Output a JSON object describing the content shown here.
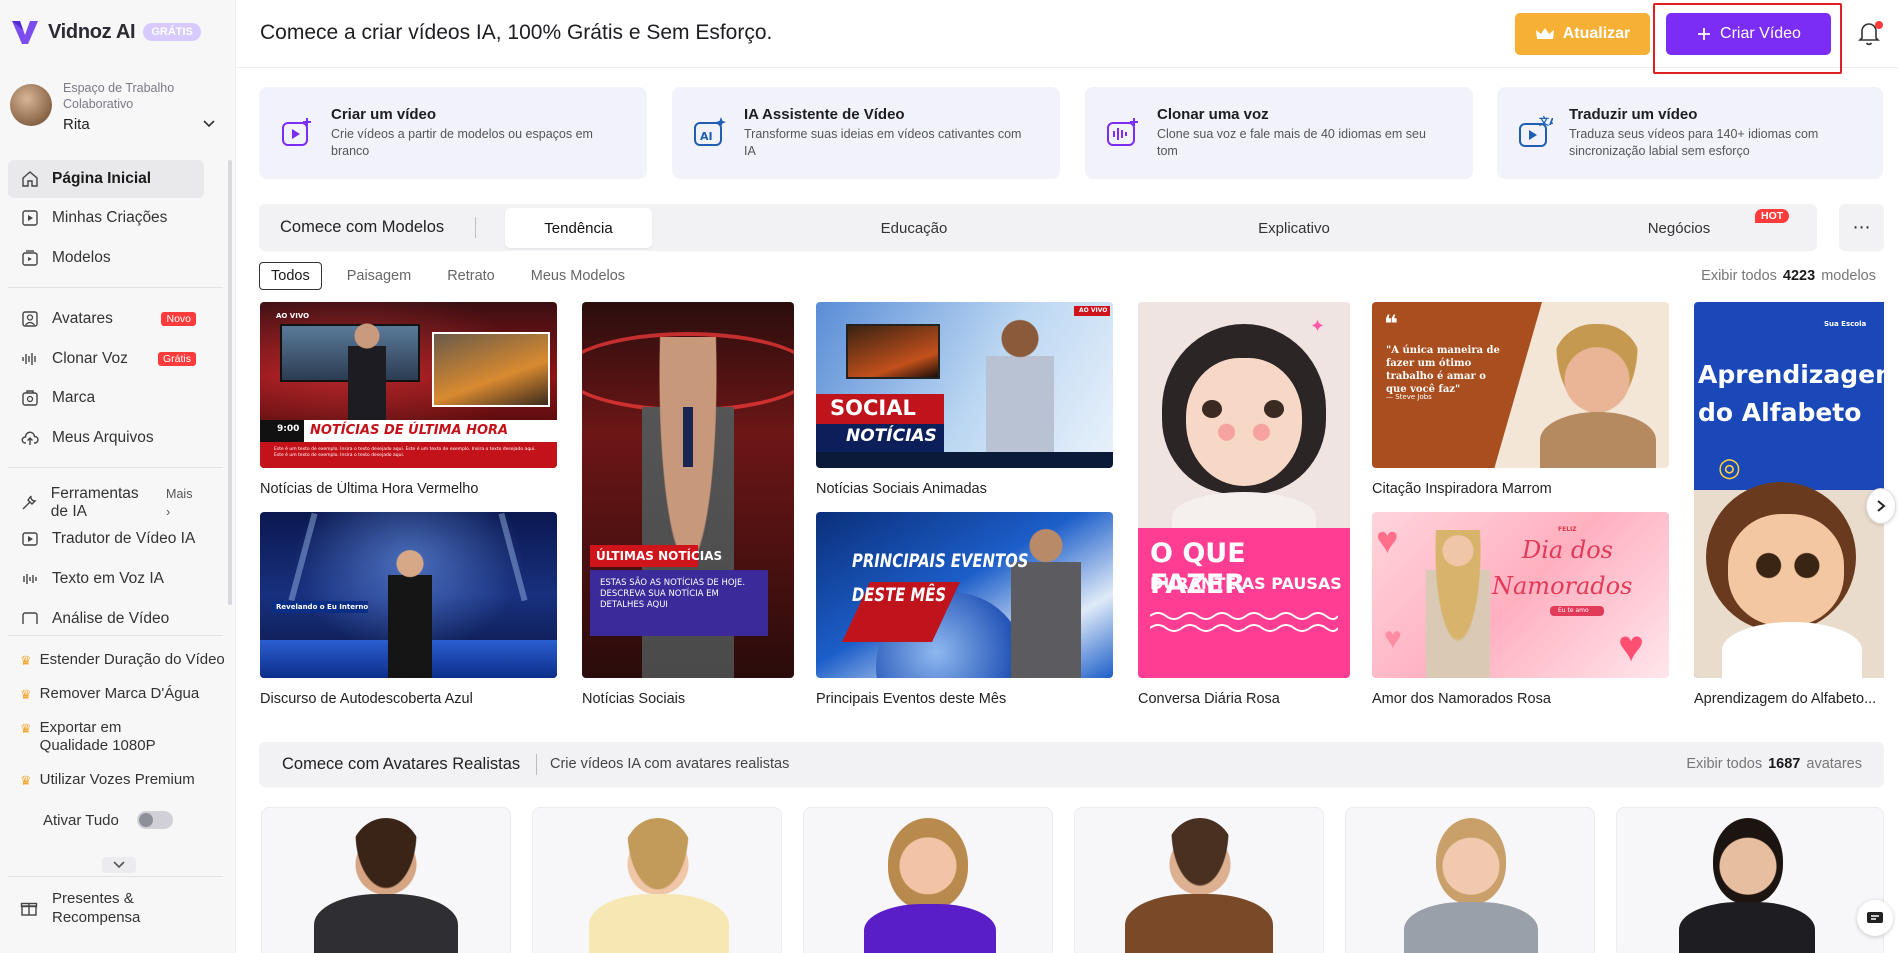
{
  "app": {
    "name": "Vidnoz AI",
    "plan_badge": "GRÁTIS",
    "workspace_label": "Espaço de Trabalho Colaborativo",
    "workspace_user": "Rita"
  },
  "sidebar": {
    "main_items": [
      {
        "label": "Página Inicial",
        "icon": "home-icon"
      },
      {
        "label": "Minhas Criações",
        "icon": "play-square-icon"
      },
      {
        "label": "Modelos",
        "icon": "template-icon"
      }
    ],
    "tool_items": [
      {
        "label": "Avatares",
        "icon": "avatar-icon",
        "badge": "Novo"
      },
      {
        "label": "Clonar Voz",
        "icon": "waveform-icon",
        "badge": "Grátis"
      },
      {
        "label": "Marca",
        "icon": "brand-icon"
      },
      {
        "label": "Meus Arquivos",
        "icon": "cloud-upload-icon"
      }
    ],
    "ai_tools": {
      "label": "Ferramentas de IA",
      "more": "Mais"
    },
    "ai_items": [
      {
        "label": "Tradutor de Vídeo IA",
        "icon": "translate-video-icon"
      },
      {
        "label": "Texto em Voz IA",
        "icon": "tts-icon"
      },
      {
        "label": "Análise de Vídeo",
        "icon": "analysis-icon"
      }
    ],
    "premium_items": [
      "Estender Duração do Vídeo",
      "Remover Marca D'Água",
      "Exportar em Qualidade 1080P",
      "Utilizar Vozes Premium"
    ],
    "activate_all": "Ativar Tudo",
    "gifts": "Presentes & Recompensa"
  },
  "header": {
    "title": "Comece a criar vídeos IA, 100% Grátis e Sem Esforço.",
    "upgrade_label": "Atualizar",
    "create_label": "Criar Vídeo"
  },
  "features": [
    {
      "title": "Criar um vídeo",
      "desc": "Crie vídeos a partir de modelos ou espaços em branco"
    },
    {
      "title": "IA Assistente de Vídeo",
      "desc": "Transforme suas ideias em vídeos cativantes com IA"
    },
    {
      "title": "Clonar uma voz",
      "desc": "Clone sua voz e fale mais de 40 idiomas em seu tom"
    },
    {
      "title": "Traduzir um vídeo",
      "desc": "Traduza seus vídeos para 140+ idiomas com sincronização labial sem esforço"
    }
  ],
  "templates": {
    "section_label": "Comece com Modelos",
    "tabs": [
      "Tendência",
      "Educação",
      "Explicativo",
      "Negócios"
    ],
    "hot_badge": "HOT",
    "filters": [
      "Todos",
      "Paisagem",
      "Retrato",
      "Meus Modelos"
    ],
    "count_prefix": "Exibir todos",
    "count": "4223",
    "count_suffix": "modelos",
    "items": [
      "Notícias de Última Hora Vermelho",
      "Discurso de Autodescoberta Azul",
      "Notícias Sociais",
      "Notícias Sociais Animadas",
      "Principais Eventos deste Mês",
      "Conversa Diária Rosa",
      "Citação Inspiradora Marrom",
      "Amor dos Namorados Rosa",
      "Aprendizagem do Alfabeto..."
    ],
    "overlays": {
      "t1_live": "AO VIVO",
      "t1_time": "9:00",
      "t1_headline": "NOTÍCIAS DE ÚLTIMA HORA",
      "t1_ticker": "Este é um texto de exemplo. Insira o texto desejado aqui. Este é um texto de exemplo. Insira o texto desejado aqui. Este é um texto de exemplo. Insira o texto desejado aqui.",
      "t2_tag": "Revelando o Eu Interno",
      "t3_headline": "ÚLTIMAS NOTÍCIAS",
      "t3_body": "ESTAS SÃO AS NOTÍCIAS DE HOJE. DESCREVA SUA NOTÍCIA EM DETALHES AQUI",
      "t4_line1": "SOCIAL",
      "t4_line2": "NOTÍCIAS",
      "t4_live": "AO VIVO",
      "t5_line1": "PRINCIPAIS EVENTOS",
      "t5_line2": "DESTE MÊS",
      "t6_line1": "O QUE FAZER",
      "t6_line2": "DURANTE AS PAUSAS",
      "t7_quote": "\"A única maneira de fazer um ótimo trabalho é amar o que você faz\"",
      "t7_author": "— Steve Jobs",
      "t8_small": "FELIZ",
      "t8_line1": "Dia dos",
      "t8_line2": "Namorados",
      "t8_tag": "Eu te amo",
      "t9_brand": "Sua Escola",
      "t9_line1": "Aprendizagem",
      "t9_line2": "do Alfabeto"
    }
  },
  "avatars": {
    "section_label": "Comece com Avatares Realistas",
    "subtitle": "Crie vídeos IA com avatares realistas",
    "count_prefix": "Exibir todos",
    "count": "1687",
    "count_suffix": "avatares"
  },
  "colors": {
    "accent": "#7b2cf5",
    "upgrade": "#f6b035",
    "badge_red": "#ff3b3b"
  }
}
